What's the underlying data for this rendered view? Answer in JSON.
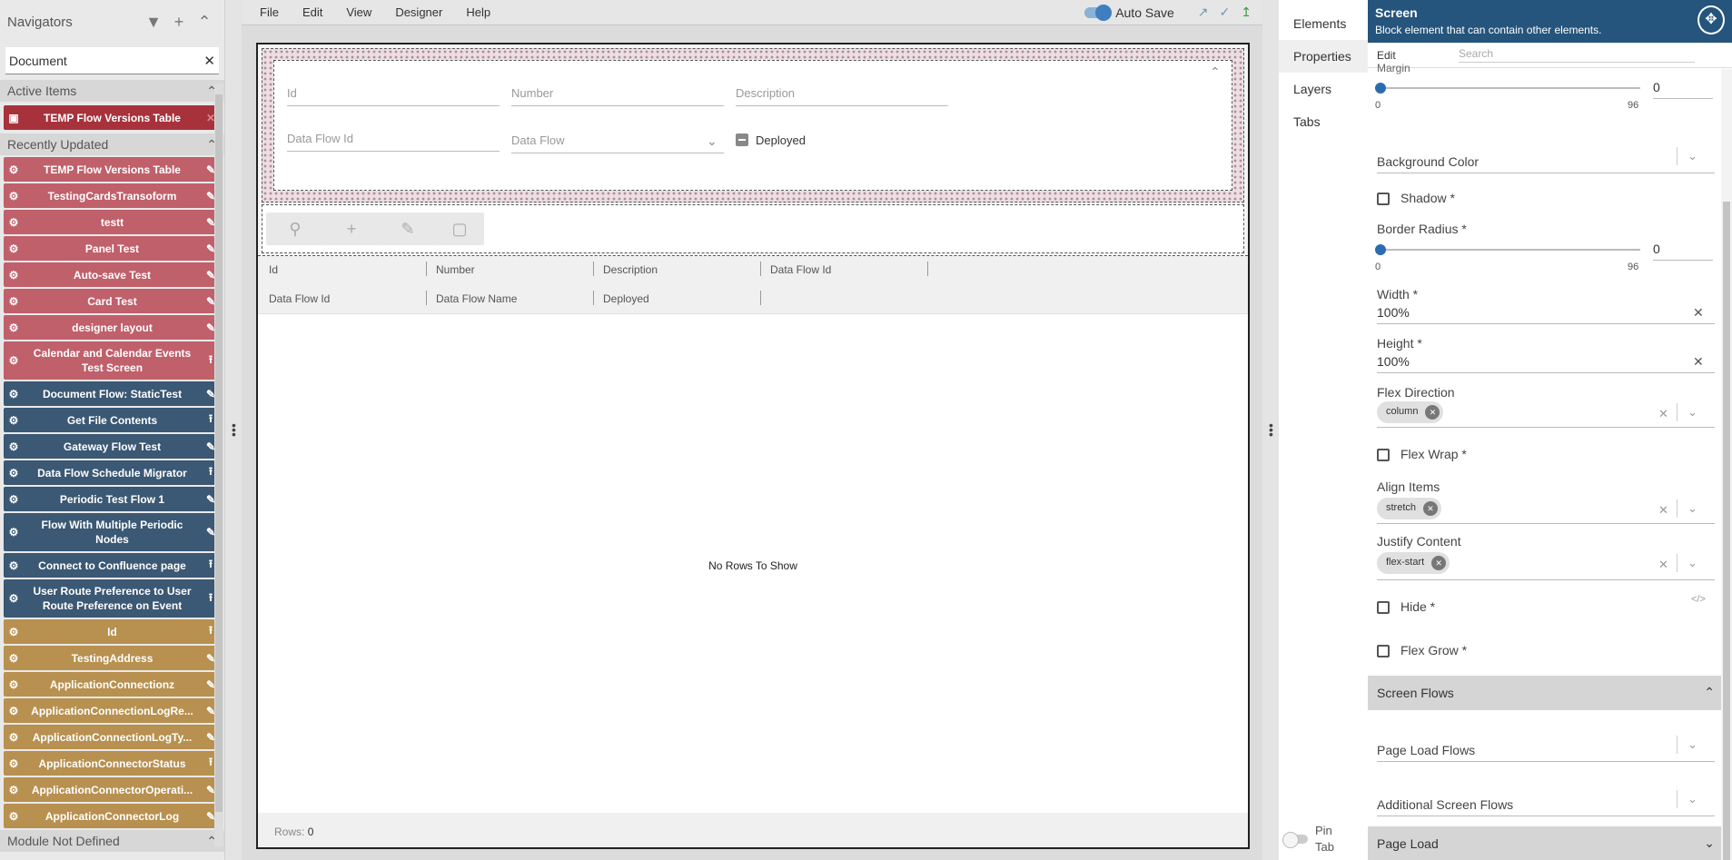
{
  "navigator": {
    "title": "Navigators",
    "icons": {
      "filter": "filter-icon",
      "add": "plus-icon",
      "collapse": "chevron-up-icon"
    },
    "search_value": "Document",
    "active_section": "Active Items",
    "recent_section": "Recently Updated",
    "module_section": "Module Not Defined",
    "active_items": [
      {
        "label": "TEMP Flow Versions Table",
        "color": "#a8323c"
      }
    ],
    "recent_items": [
      {
        "label": "TEMP Flow Versions Table",
        "color": "red",
        "action": "edit"
      },
      {
        "label": "TestingCardsTransoform",
        "color": "red",
        "action": "edit"
      },
      {
        "label": "testt",
        "color": "red",
        "action": "edit"
      },
      {
        "label": "Panel Test",
        "color": "red",
        "action": "edit"
      },
      {
        "label": "Auto-save Test",
        "color": "red",
        "action": "edit"
      },
      {
        "label": "Card Test",
        "color": "red",
        "action": "edit"
      },
      {
        "label": "designer layout",
        "color": "red",
        "action": "edit"
      },
      {
        "label": "Calendar and Calendar Events Test Screen",
        "color": "red",
        "action": "upload",
        "tall": true
      },
      {
        "label": "Document Flow: StaticTest",
        "color": "blue",
        "action": "edit"
      },
      {
        "label": "Get File Contents",
        "color": "blue",
        "action": "upload"
      },
      {
        "label": "Gateway Flow Test",
        "color": "blue",
        "action": "edit"
      },
      {
        "label": "Data Flow Schedule Migrator",
        "color": "blue",
        "action": "upload"
      },
      {
        "label": "Periodic Test Flow 1",
        "color": "blue",
        "action": "edit"
      },
      {
        "label": "Flow With Multiple Periodic Nodes",
        "color": "blue",
        "action": "edit",
        "tall": true
      },
      {
        "label": "Connect to Confluence page",
        "color": "blue",
        "action": "upload"
      },
      {
        "label": "User Route Preference to User Route Preference on Event",
        "color": "blue",
        "action": "upload",
        "tall": true
      },
      {
        "label": "Id",
        "color": "gold",
        "action": "upload"
      },
      {
        "label": "TestingAddress",
        "color": "gold",
        "action": "edit"
      },
      {
        "label": "ApplicationConnectionz",
        "color": "gold",
        "action": "edit"
      },
      {
        "label": "ApplicationConnectionLogRe...",
        "color": "gold",
        "action": "edit"
      },
      {
        "label": "ApplicationConnectionLogTy...",
        "color": "gold",
        "action": "edit"
      },
      {
        "label": "ApplicationConnectorStatus",
        "color": "gold",
        "action": "upload"
      },
      {
        "label": "ApplicationConnectorOperati...",
        "color": "gold",
        "action": "edit"
      },
      {
        "label": "ApplicationConnectorLog",
        "color": "gold",
        "action": "edit"
      }
    ]
  },
  "menu": {
    "items": [
      "File",
      "Edit",
      "View",
      "Designer",
      "Help"
    ],
    "auto_save": "Auto Save"
  },
  "form": {
    "fields": {
      "id": "Id",
      "number": "Number",
      "description": "Description",
      "data_flow_id": "Data Flow Id",
      "data_flow": "Data Flow",
      "deployed": "Deployed"
    }
  },
  "toolbar": {
    "buttons": [
      "search-icon",
      "plus-icon",
      "pencil-icon",
      "trash-icon"
    ]
  },
  "grid": {
    "header_row1": [
      "Id",
      "Number",
      "Description",
      "Data Flow Id"
    ],
    "header_row2": [
      "Data Flow Id",
      "Data Flow Name",
      "Deployed"
    ],
    "empty": "No Rows To Show",
    "rows_label": "Rows:",
    "rows_count": "0"
  },
  "right_tabs": {
    "items": [
      "Elements",
      "Properties",
      "Layers",
      "Tabs"
    ],
    "active": "Properties",
    "pin_tab": "Pin Tab"
  },
  "properties": {
    "title": "Screen",
    "subtitle": "Block element that can contain other elements.",
    "edit_tab": "Edit",
    "search_placeholder": "Search",
    "margin_label": "Margin",
    "margin_value": "0",
    "margin_min": "0",
    "margin_max": "96",
    "background_color": "Background Color",
    "shadow": "Shadow *",
    "border_radius": "Border Radius *",
    "border_radius_value": "0",
    "border_radius_min": "0",
    "border_radius_max": "96",
    "width_label": "Width *",
    "width_value": "100%",
    "height_label": "Height *",
    "height_value": "100%",
    "flex_direction": "Flex Direction",
    "flex_direction_value": "column",
    "flex_wrap": "Flex Wrap *",
    "align_items": "Align Items",
    "align_items_value": "stretch",
    "justify_content": "Justify Content",
    "justify_content_value": "flex-start",
    "code_toggle": "</>",
    "hide": "Hide *",
    "flex_grow": "Flex Grow *",
    "screen_flows": "Screen Flows",
    "page_load_flows": "Page Load Flows",
    "additional_screen_flows": "Additional Screen Flows",
    "page_load": "Page Load"
  },
  "colors": {
    "red": "#c0606b",
    "dark_red": "#a8323c",
    "blue": "#3b5874",
    "gold": "#b8904f",
    "header": "#25547c"
  }
}
